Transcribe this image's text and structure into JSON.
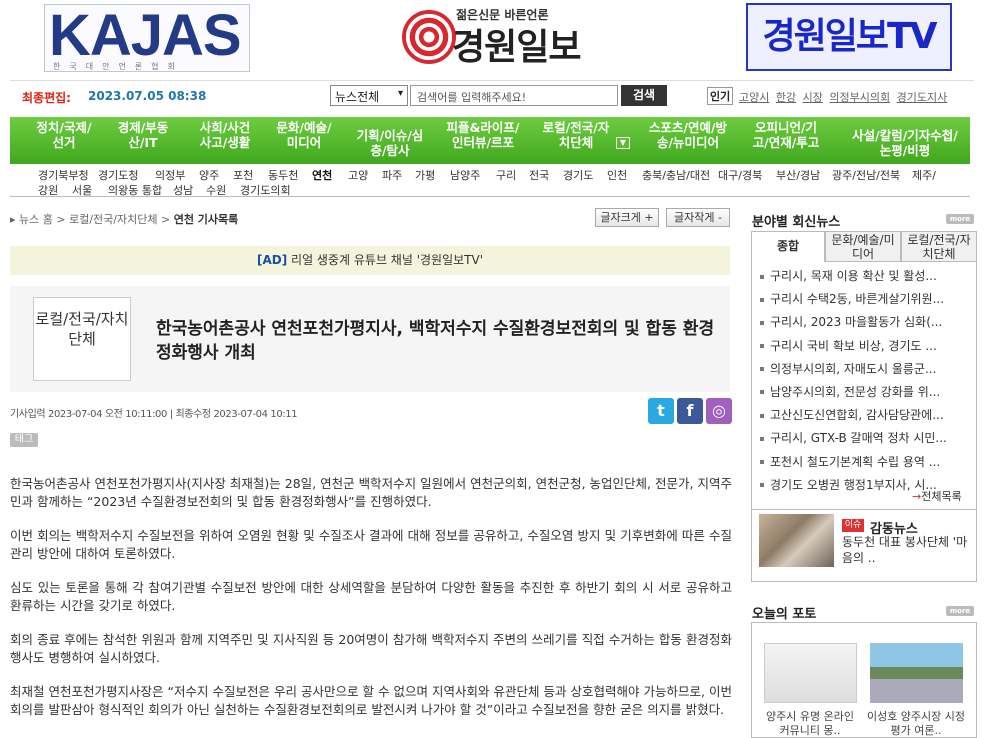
{
  "header": {
    "kajas_logo": "KAJAS",
    "kajas_sub": "한국대안언론협회",
    "main_logo_tag": "젊은신문 바른언론",
    "main_logo_name": "경원일보",
    "tv_logo": "경원일보TV"
  },
  "infobar": {
    "edit_label": "최종편집:",
    "edit_time": "2023.07.05 08:38",
    "search_select": "뉴스전체",
    "search_placeholder": "검색어를 입력해주세요!",
    "search_button": "검색",
    "popular_label": "인기",
    "popular": [
      "고양시",
      "한강",
      "시장",
      "의정부시의회",
      "경기도지사"
    ]
  },
  "nav": {
    "main": [
      "정치/국제/선거",
      "경제/부동산/IT",
      "사회/사건사고/생활",
      "문화/예술/미디어",
      "기획/이슈/심층/탐사",
      "피플&라이프/인터뷰/르포",
      "로컬/전국/자치단체",
      "스포츠/연예/방송/뉴미디어",
      "오피니언/기고/연재/투고",
      "사설/칼럼/기자수첩/논평/비평"
    ],
    "sub_row1": [
      "경기북부청",
      "경기도청",
      "의정부",
      "양주",
      "포천",
      "동두천",
      "연천",
      "고양",
      "파주",
      "가평",
      "남양주",
      "구리",
      "전국",
      "경기도",
      "인천",
      "충북/충남/대전",
      "대구/경북",
      "부산/경남",
      "광주/전남/전북",
      "제주/"
    ],
    "sub_row2": [
      "강원",
      "서울",
      "의왕동 통합",
      "성남",
      "수원",
      "경기도의회"
    ]
  },
  "article": {
    "breadcrumb_home": "뉴스 홈",
    "breadcrumb_cat": "로컬/전국/자치단체",
    "breadcrumb_current": "연천 기사목록",
    "font_up": "글자크게 +",
    "font_down": "글자작게 -",
    "ad_tag": "[AD]",
    "ad_text": "리얼 생중계 유튜브 채널 '경원일보TV'",
    "category": "로컬/전국/자치단체",
    "headline": "한국농어촌공사 연천포천가평지사, 백학저수지 수질환경보전회의 및 합동 환경정화행사 개최",
    "meta": "기사입력 2023-07-04 오전 10:11:00 | 최종수정 2023-07-04 10:11",
    "tag_label": "태그",
    "paragraphs": [
      "한국농어촌공사 연천포천가평지사(지사장 최재철)는 28일, 연천군 백학저수지 일원에서 연천군의회, 연천군청, 농업인단체, 전문가, 지역주민과 함께하는 “2023년 수질환경보전회의 및 합동 환경정화행사”를 진행하였다.",
      "이번 회의는 백학저수지 수질보전을 위하여 오염원 현황 및 수질조사 결과에 대해 정보를 공유하고, 수질오염 방지 및 기후변화에 따른 수질관리 방안에 대하여 토론하였다.",
      "심도 있는 토론을 통해 각 참여기관별 수질보전 방안에 대한 상세역할을 분담하여 다양한 활동을 추진한 후 하반기 회의 시 서로 공유하고 환류하는 시간을 갖기로 하였다.",
      "회의 종료 후에는 참석한 위원과 함께 지역주민 및 지사직원 등 20여명이 참가해 백학저수지 주변의 쓰레기를 직접 수거하는 합동 환경정화행사도 병행하여 실시하였다.",
      "최재철 연천포천가평지사장은 “저수지 수질보전은 우리 공사만으로 할 수 없으며 지역사회와 유관단체 등과 상호협력해야 가능하므로, 이번 회의를 발판삼아 형식적인 회의가 아닌 실천하는 수질환경보전회의로 발전시켜 나가야 할 것”이라고 수질보전을 향한 굳은 의지를 밝혔다."
    ]
  },
  "sidebar": {
    "title": "분야별 회신뉴스",
    "more": "more",
    "tabs": [
      "종합",
      "문화/예술/미디어",
      "로컬/전국/자치단체"
    ],
    "items": [
      "구리시, 목재 이용 확산 및 활성...",
      "구리시 수택2동, 바른게살기위원...",
      "구리시, 2023 마을활동가 심화(...",
      "구리시 국비 확보 비상, 경기도 ...",
      "의정부시의회, 자매도시 울릉군...",
      "남양주시의회, 전문성 강화를 위...",
      "고산신도신연합회, 감사담당관에...",
      "구리시, GTX-B 갈매역 정차 시민...",
      "포천시 철도기본계획 수립 용역 ...",
      "경기도 오병권 행정1부지사, 시..."
    ],
    "all_list": "전체목록",
    "emo_badge": "이슈",
    "emo_title": "감동뉴스",
    "emo_text": "동두천 대표 봉사단체 '마음의 ..",
    "photo_title": "오늘의 포토",
    "photo_caps": [
      "양주시 유명 온라인 커뮤니티 몽..",
      "이성호 양주시장 시정 평가 여론.."
    ]
  },
  "colors": {
    "nav_green": "#4fb82a",
    "edit_red": "#d21",
    "edit_blue": "#27a",
    "twitter": "#1da1f2",
    "facebook": "#3b5998",
    "kakao": "#a060c0"
  }
}
